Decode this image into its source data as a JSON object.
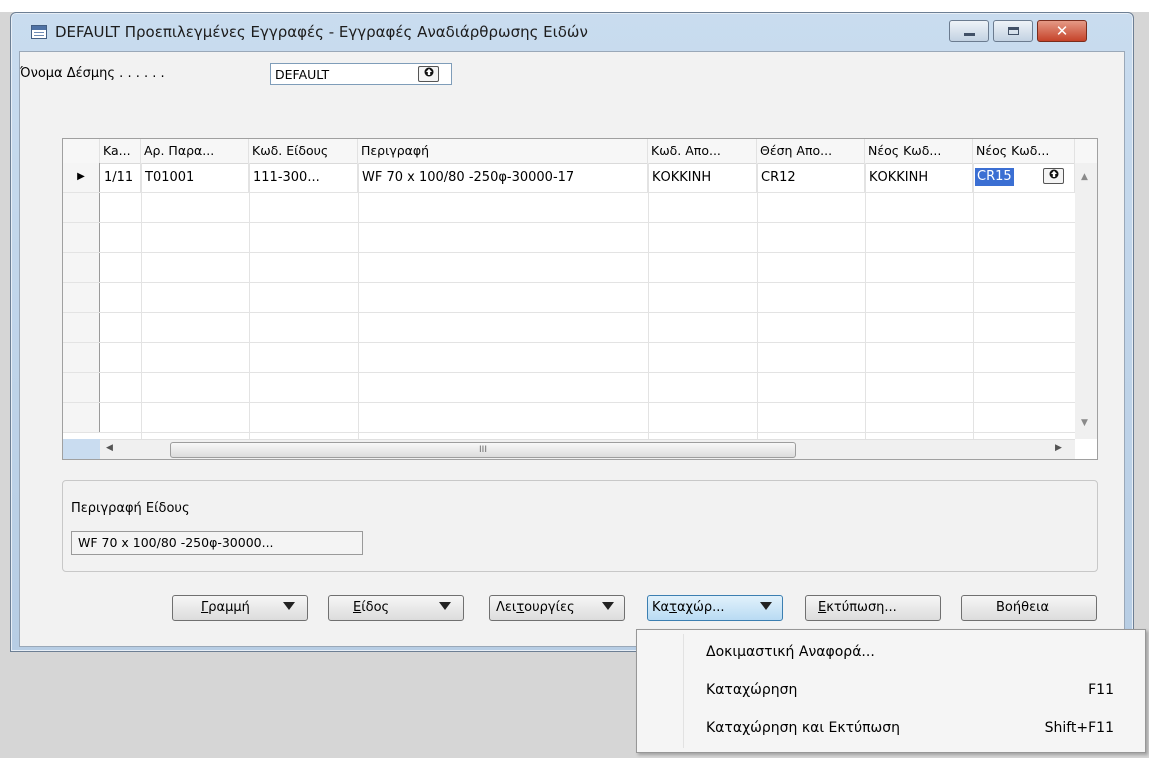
{
  "window": {
    "title": "DEFAULT Προεπιλεγμένες Εγγραφές - Εγγραφές Αναδιάρθρωσης Ειδών",
    "close_glyph": "✕"
  },
  "batch": {
    "label": "Όνομα Δέσμης . . . . . .",
    "value": "DEFAULT"
  },
  "grid": {
    "columns": [
      "Ka...",
      "Αρ. Παρα...",
      "Κωδ. Είδους",
      "Περιγραφή",
      "Κωδ. Απο...",
      "Θέση Απο...",
      "Νέος Κωδ...",
      "Νέος Κωδ..."
    ],
    "rows": [
      {
        "date": "1/11",
        "doc_no": "T01001",
        "item_no": "111-300...",
        "description": "WF 70 x 100/80 -250φ-30000-17",
        "location_code": "ΚΟΚΚΙΝΗ",
        "bin_code": "CR12",
        "new_location_code": "ΚΟΚΚΙΝΗ",
        "new_bin_code": "CR15"
      }
    ],
    "current_row_marker": "▶",
    "hscroll_thumb_grip": "III"
  },
  "item_description_panel": {
    "label": "Περιγραφή Είδους",
    "value": "WF 70 x 100/80 -250φ-30000..."
  },
  "buttons": {
    "line": {
      "accel": "Γ",
      "rest": "ραμμή"
    },
    "item": {
      "accel": "Ε",
      "rest": "ίδος"
    },
    "functions": {
      "pre": "Λει",
      "accel": "τ",
      "rest": "ουργίες"
    },
    "posting": {
      "pre": "Κα",
      "accel": "τ",
      "rest": "αχώρ..."
    },
    "print": {
      "accel": "Ε",
      "rest": "κτύπωση..."
    },
    "help": "Βοήθεια"
  },
  "posting_menu": [
    {
      "label": "Δοκιμαστική Αναφορά...",
      "shortcut": ""
    },
    {
      "label": "Καταχώρηση",
      "shortcut": "F11"
    },
    {
      "label": "Καταχώρηση και Εκτύπωση",
      "shortcut": "Shift+F11"
    }
  ],
  "icons": {
    "window": "window-grid-icon",
    "lookup": "lookup-arrow-icon",
    "dropdown": "caret-down-icon"
  },
  "colors": {
    "selection": "#3b6fd3",
    "close_button": "#c5432a",
    "frame": "#b7cde4"
  }
}
